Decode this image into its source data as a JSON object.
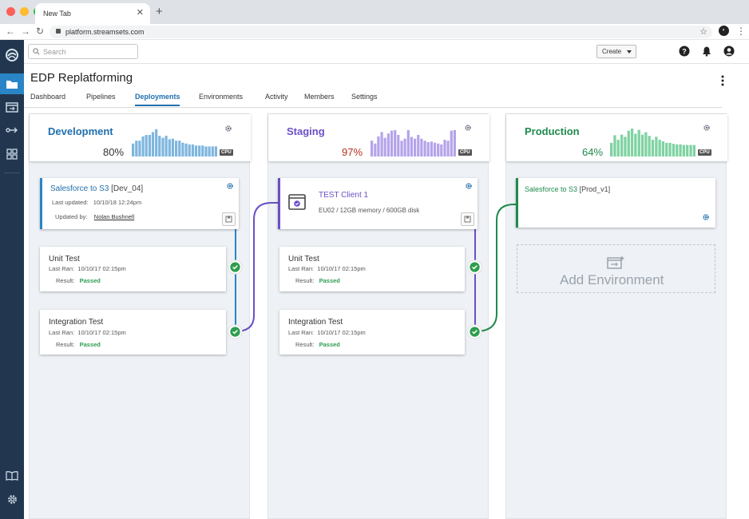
{
  "browser": {
    "tab_title": "New Tab",
    "url": "platform.streamsets.com"
  },
  "header": {
    "search_placeholder": "Search",
    "create_label": "Create"
  },
  "page": {
    "title": "EDP Replatforming",
    "tabs": [
      {
        "label": "Dashboard"
      },
      {
        "label": "Pipelines"
      },
      {
        "label": "Deployments",
        "active": true
      },
      {
        "label": "Environments"
      },
      {
        "label": "Activity"
      },
      {
        "label": "Members"
      },
      {
        "label": "Settings"
      }
    ]
  },
  "colors": {
    "development": "#1f6fae",
    "staging": "#6a4fc6",
    "production": "#1f8a4c",
    "development_bars": "#7eb6de",
    "staging_bars": "#b5a3ea",
    "production_bars": "#7fd3a2",
    "passed": "#2e9d4f"
  },
  "environments": {
    "development": {
      "name": "Development",
      "cpu_percent": "80%",
      "cpu_label": "CPU",
      "pct_color": "#333333",
      "cpu_history": [
        0.45,
        0.55,
        0.55,
        0.7,
        0.75,
        0.75,
        0.85,
        0.95,
        0.72,
        0.65,
        0.72,
        0.6,
        0.62,
        0.55,
        0.55,
        0.48,
        0.45,
        0.42,
        0.42,
        0.38,
        0.38,
        0.38,
        0.35,
        0.35,
        0.35,
        0.35
      ]
    },
    "staging": {
      "name": "Staging",
      "cpu_percent": "97%",
      "cpu_label": "CPU",
      "pct_color": "#b5311e",
      "cpu_history": [
        0.55,
        0.45,
        0.7,
        0.85,
        0.65,
        0.8,
        0.9,
        0.92,
        0.75,
        0.55,
        0.62,
        0.92,
        0.68,
        0.62,
        0.75,
        0.62,
        0.55,
        0.5,
        0.52,
        0.48,
        0.45,
        0.42,
        0.58,
        0.55,
        0.9,
        0.92
      ]
    },
    "production": {
      "name": "Production",
      "cpu_percent": "64%",
      "cpu_label": "CPU",
      "pct_color": "#1f8a4c",
      "cpu_history": [
        0.45,
        0.7,
        0.55,
        0.72,
        0.65,
        0.85,
        0.92,
        0.75,
        0.88,
        0.72,
        0.8,
        0.68,
        0.55,
        0.65,
        0.55,
        0.5,
        0.45,
        0.45,
        0.42,
        0.4,
        0.4,
        0.38,
        0.38,
        0.38,
        0.38
      ]
    }
  },
  "dev_pipeline": {
    "name": "Salesforce to S3",
    "version": "[Dev_04]",
    "last_updated_label": "Last updated:",
    "last_updated": "10/10/18 12:24pm",
    "updated_by_label": "Updated by:",
    "updated_by": "Nolan Bushnell"
  },
  "staging_client": {
    "name": "TEST Client 1",
    "details": "EU02 /  12GB memory / 600GB disk"
  },
  "prod_pipeline": {
    "name": "Salesforce to S3",
    "version": "[Prod_v1]"
  },
  "tests": {
    "unit_title": "Unit Test",
    "integration_title": "Integration Test",
    "last_ran_label": "Last Ran:",
    "result_label": "Result:",
    "dev_unit": {
      "last_ran": "10/10/17 02:15pm",
      "result": "Passed"
    },
    "dev_integration": {
      "last_ran": "10/10/17 02:15pm",
      "result": "Passed"
    },
    "stg_unit": {
      "last_ran": "10/10/17 02:15pm",
      "result": "Passed"
    },
    "stg_integration": {
      "last_ran": "10/10/17 02:15pm",
      "result": "Passed"
    }
  },
  "add_environment_label": "Add Environment",
  "icons": {
    "rail": [
      "streamsets-logo-icon",
      "folder-icon",
      "deployment-icon",
      "pipeline-arrow-icon",
      "grid-icon",
      "book-icon",
      "settings-gear-icon"
    ],
    "header": [
      "help-icon",
      "bell-icon",
      "user-icon"
    ]
  }
}
